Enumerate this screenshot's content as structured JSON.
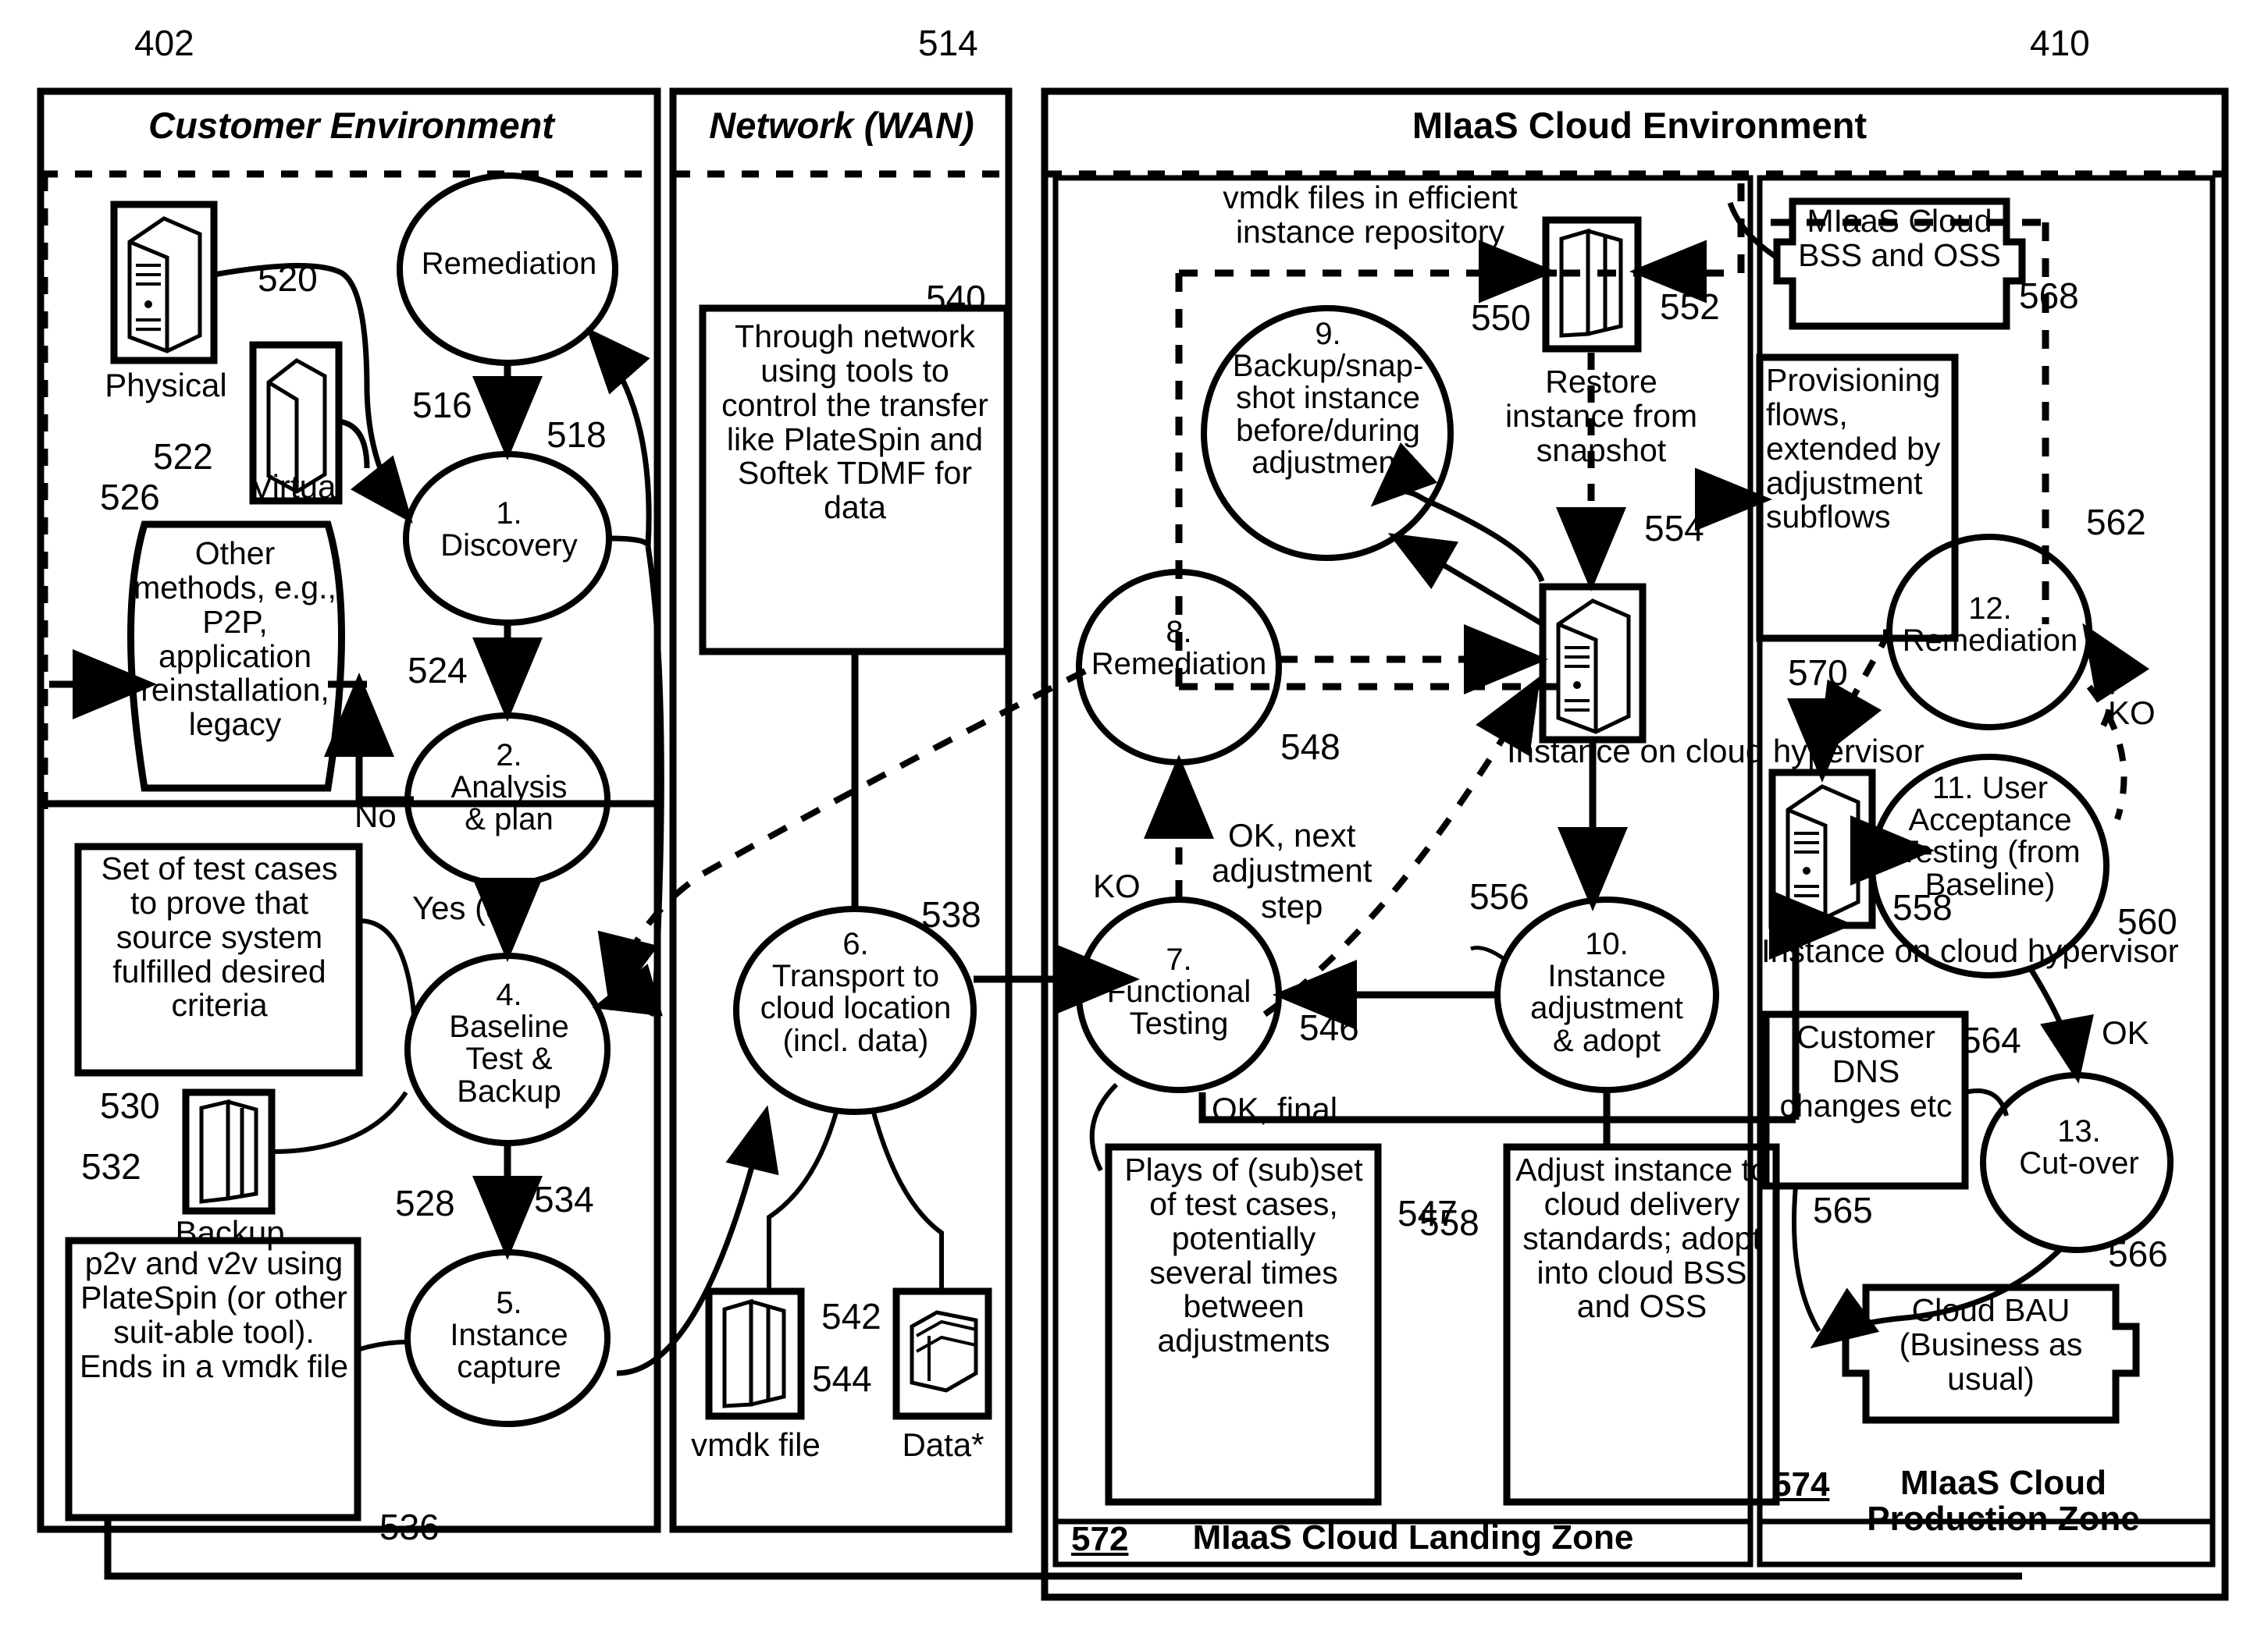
{
  "figure": {
    "zones": [
      {
        "id": "customer",
        "title": "Customer Environment",
        "ref": "402"
      },
      {
        "id": "network",
        "title": "Network (WAN)",
        "ref": "514"
      },
      {
        "id": "cloud",
        "title": "MIaaS Cloud Environment",
        "ref": "410"
      }
    ],
    "subzones": [
      {
        "id": "landing",
        "ref": "572",
        "title": "MIaaS Cloud Landing Zone"
      },
      {
        "id": "production",
        "ref": "574",
        "title": "MIaaS Cloud Production Zone"
      }
    ],
    "customer_env": {
      "icons": [
        {
          "name": "physical-server",
          "caption": "Physical",
          "ref": "520"
        },
        {
          "name": "virtual-server",
          "caption": "Virtual",
          "ref": "522"
        },
        {
          "name": "backup-media",
          "caption": "Backup",
          "ref": "532"
        }
      ],
      "nodes": [
        {
          "ref": "516",
          "label": "Remediation"
        },
        {
          "ref": "518",
          "label": "1.\nDiscovery"
        },
        {
          "ref": "524",
          "label": "2.\nAnalysis\n& plan"
        },
        {
          "ref": "528",
          "label": "4.\nBaseline\nTest &\nBackup"
        },
        {
          "ref": "536",
          "label": "5.\nInstance\ncapture"
        }
      ],
      "notes": [
        {
          "ref": "526",
          "text": "Other methods, e.g., P2P, application reinstallation, legacy"
        },
        {
          "ref": "530",
          "text": "Set of test cases to prove that  source system fulfilled desired criteria"
        },
        {
          "ref": "534",
          "text": "p2v and v2v using PlateSpin (or other suit-able tool). Ends in a vmdk file"
        }
      ],
      "edge_labels": [
        {
          "name": "no-branch",
          "text": "No"
        },
        {
          "name": "yes-branch",
          "text": "Yes  (3)"
        }
      ]
    },
    "network_env": {
      "notes": [
        {
          "ref": "540",
          "text": "Through network using tools to control the transfer like PlateSpin and Softek TDMF for data"
        }
      ],
      "nodes": [
        {
          "ref": "538",
          "label": "6.\nTransport to\ncloud location\n(incl. data)"
        }
      ],
      "icons": [
        {
          "name": "vmdk-file",
          "caption": "vmdk file",
          "ref": "542"
        },
        {
          "name": "data-store",
          "caption": "Data*",
          "ref": "544"
        }
      ]
    },
    "cloud_env": {
      "repository_caption": "vmdk files in efficient instance repository",
      "restore_caption": "Restore instance from snapshot",
      "icons": [
        {
          "name": "instance-repository",
          "caption": "",
          "ref": "552"
        },
        {
          "name": "cloud-hypervisor-instance",
          "caption": "Instance on cloud hypervisor",
          "ref": "554"
        },
        {
          "name": "production-hypervisor-instance",
          "caption": "Instance on cloud hypervisor",
          "ref": "558"
        }
      ],
      "nodes": [
        {
          "ref": "550",
          "label": "9.\nBackup/snap-\nshot instance\nbefore/during\nadjustment"
        },
        {
          "ref": "548",
          "label": "8.\nRemediation"
        },
        {
          "ref": "546",
          "label": "7.\nFunctional\nTesting"
        },
        {
          "ref": "556",
          "label": "10.\nInstance\nadjustment\n& adopt"
        },
        {
          "ref": "562",
          "label": "12.\nRemediation"
        },
        {
          "ref": "560",
          "label": "11. User\nAcceptance\nTesting (from\nBaseline)"
        },
        {
          "ref": "564",
          "label": "13.\nCut-over"
        }
      ],
      "notes": [
        {
          "ref": "547",
          "text": "Plays of (sub)set of test cases, potentially several times between adjustments"
        },
        {
          "ref": "558",
          "text": "Adjust instance to cloud delivery standards; adopt into cloud BSS and OSS"
        },
        {
          "ref": "568",
          "text": "MIaaS Cloud BSS and OSS"
        },
        {
          "ref": "570",
          "text": "Provisioning flows, extended by adjustment subflows"
        },
        {
          "ref": "565",
          "text": "Customer DNS changes etc"
        },
        {
          "ref": "566",
          "text": "Cloud BAU (Business as usual)"
        }
      ],
      "edge_labels": [
        {
          "name": "ok-next-adjustment",
          "text": "OK, next\nadjustment\nstep"
        },
        {
          "name": "ko-functional",
          "text": "KO"
        },
        {
          "name": "ok-final",
          "text": "OK, final"
        },
        {
          "name": "ko-uat",
          "text": "KO"
        },
        {
          "name": "ok-cutover",
          "text": "OK"
        }
      ]
    },
    "reference_numerals": [
      "402",
      "410",
      "514",
      "516",
      "518",
      "520",
      "522",
      "524",
      "526",
      "528",
      "530",
      "532",
      "534",
      "536",
      "538",
      "540",
      "542",
      "544",
      "546",
      "547",
      "548",
      "550",
      "552",
      "554",
      "556",
      "558",
      "558",
      "560",
      "562",
      "564",
      "565",
      "566",
      "568",
      "570",
      "572",
      "574"
    ]
  }
}
